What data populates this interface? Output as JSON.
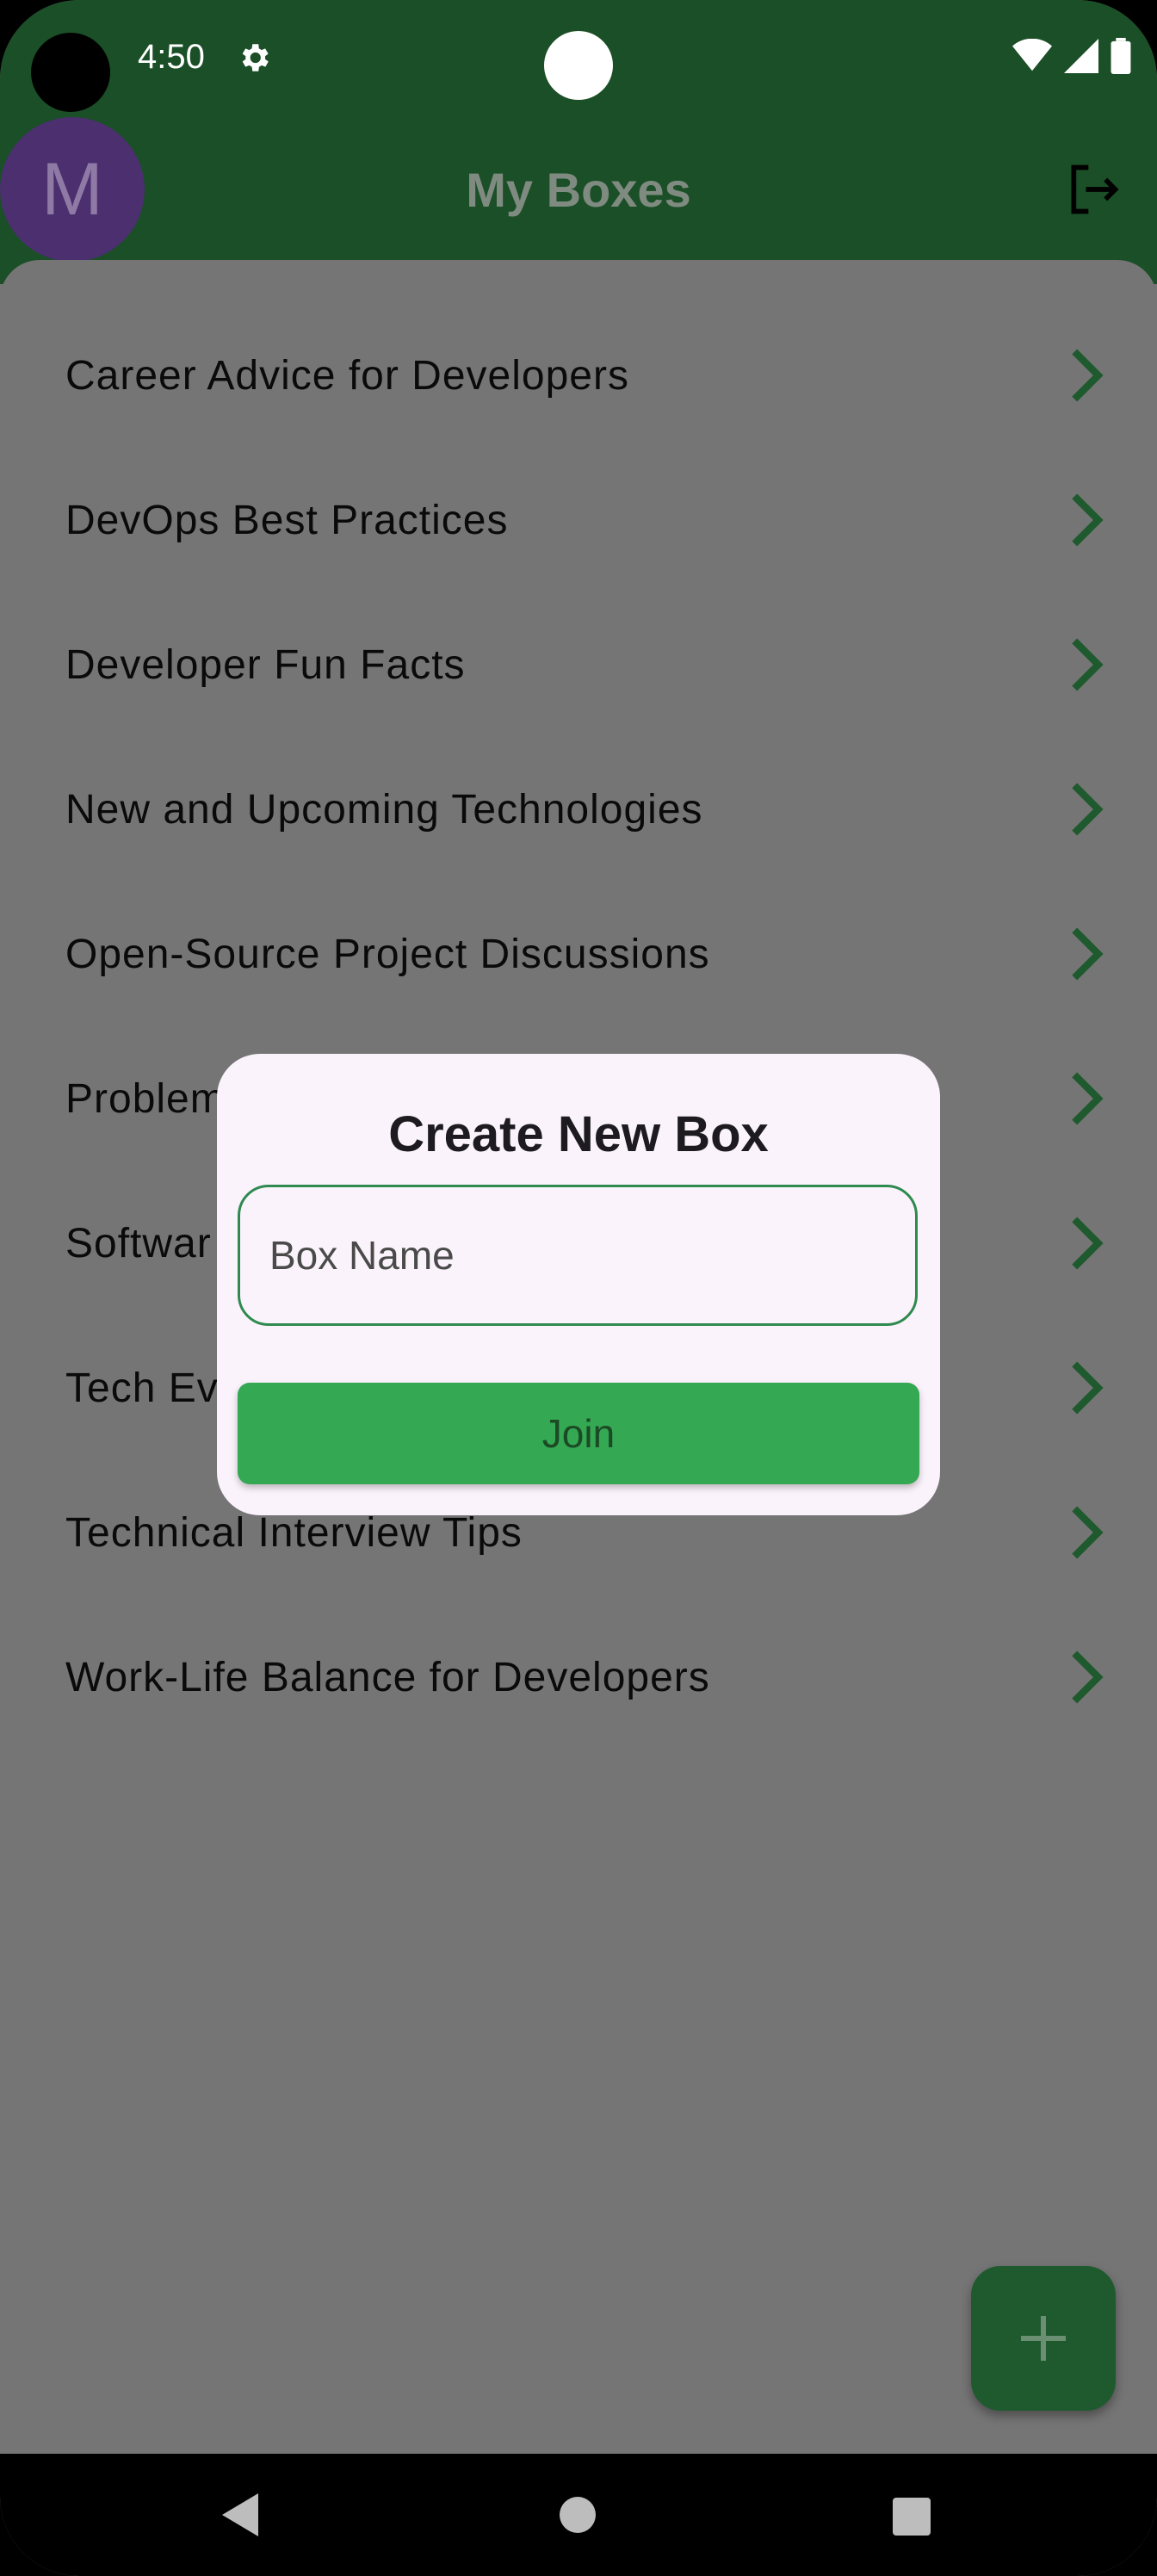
{
  "status_bar": {
    "time": "4:50",
    "icons": [
      "gear-icon",
      "wifi-icon",
      "signal-icon",
      "battery-icon"
    ]
  },
  "app_bar": {
    "avatar_initial": "M",
    "title": "My Boxes",
    "logout_icon": "logout-icon"
  },
  "boxes": [
    {
      "label": "Career Advice for Developers"
    },
    {
      "label": "DevOps Best Practices"
    },
    {
      "label": "Developer Fun Facts"
    },
    {
      "label": "New and Upcoming Technologies"
    },
    {
      "label": "Open-Source Project Discussions"
    },
    {
      "label": "Problem"
    },
    {
      "label": "Softwar"
    },
    {
      "label": "Tech Ev"
    },
    {
      "label": "Technical Interview Tips"
    },
    {
      "label": "Work-Life Balance for Developers"
    }
  ],
  "dialog": {
    "title": "Create New Box",
    "input_placeholder": "Box Name",
    "input_value": "",
    "join_label": "Join"
  },
  "fab": {
    "icon": "plus-icon"
  },
  "nav_bar": {
    "icons": [
      "back-icon",
      "home-icon",
      "recents-icon"
    ]
  },
  "colors": {
    "header": "#1b4f27",
    "accent_green": "#34a853",
    "chevron": "#1e5a2e",
    "scrim_background": "#757575",
    "dialog_background": "#fbf3fb"
  }
}
